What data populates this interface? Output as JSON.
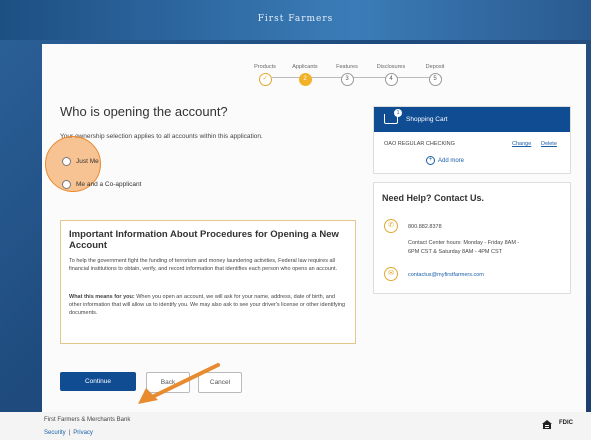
{
  "brand": "First Farmers",
  "steps": [
    {
      "label": "Products",
      "mark": "✓",
      "state": "done"
    },
    {
      "label": "Applicants",
      "mark": "2",
      "state": "active"
    },
    {
      "label": "Features",
      "mark": "3",
      "state": "todo"
    },
    {
      "label": "Disclosures",
      "mark": "4",
      "state": "todo"
    },
    {
      "label": "Deposit",
      "mark": "5",
      "state": "todo"
    }
  ],
  "main": {
    "title": "Who is opening the account?",
    "subtitle": "Your ownership selection applies to all accounts within this application.",
    "options": [
      "Just Me",
      "Me and a Co-applicant"
    ]
  },
  "info": {
    "heading": "Important Information About Procedures for Opening a New Account",
    "para1": "To help the government fight the funding of terrorism and money laundering activities, Federal law requires all financial institutions to obtain, verify, and record information that identifies each person who opens an account.",
    "para2_lead": "What this means for you:",
    "para2": "When you open an account, we will ask for your name, address, date of birth, and other information that will allow us to identify you. We may also ask to see your driver's license or other identifying documents."
  },
  "buttons": {
    "continue": "Continue",
    "back": "Back",
    "cancel": "Cancel"
  },
  "cart": {
    "title": "Shopping Cart",
    "count": "1",
    "item": "OAO REGULAR CHECKING",
    "change": "Change",
    "delete": "Delete",
    "add_more": "Add more"
  },
  "help": {
    "title": "Need Help? Contact Us.",
    "phone": "800.882.8378",
    "hours_1": "Contact Center hours: Monday - Friday 8AM -",
    "hours_2": "6PM CST & Saturday 8AM - 4PM CST",
    "email": "contactus@myfirstfarmers.com"
  },
  "footer": {
    "bank": "First Farmers & Merchants Bank",
    "security": "Security",
    "privacy": "Privacy",
    "fdic": "FDIC"
  },
  "colors": {
    "primary": "#0f4c92",
    "accent": "#f2b227",
    "highlight": "#e88a2e"
  }
}
